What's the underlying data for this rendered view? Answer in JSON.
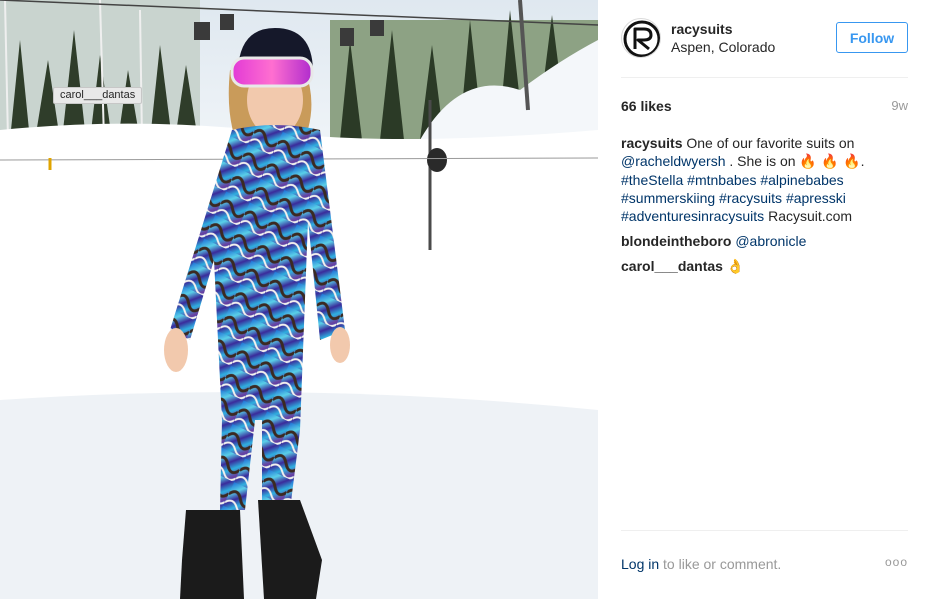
{
  "photo": {
    "tag_label": "carol___dantas"
  },
  "header": {
    "username": "racysuits",
    "location": "Aspen, Colorado",
    "follow_label": "Follow"
  },
  "stats": {
    "likes": "66 likes",
    "time": "9w"
  },
  "caption": {
    "username": "racysuits",
    "text_1": "One of our favorite suits on",
    "mention": "@racheldwyersh",
    "text_2": ". She is on",
    "emojis": "🔥 🔥 🔥",
    "text_3": ".",
    "hashtags": [
      "#theStella",
      "#mtnbabes",
      "#alpinebabes",
      "#summerskiing",
      "#racysuits",
      "#apresski",
      "#adventuresinracysuits"
    ],
    "site": "Racysuit.com"
  },
  "comments": [
    {
      "username": "blondeintheboro",
      "mention": "@abronicle",
      "emoji": ""
    },
    {
      "username": "carol___dantas",
      "mention": "",
      "emoji": "👌"
    }
  ],
  "footer": {
    "login_label": "Log in",
    "login_suffix": "to like or comment.",
    "more_label": "ooo"
  }
}
